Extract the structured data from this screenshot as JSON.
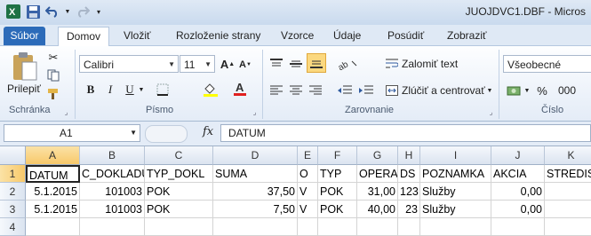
{
  "window": {
    "title": "JUOJDVC1.DBF - Micros"
  },
  "tabs": [
    {
      "label": "Súbor"
    },
    {
      "label": "Domov"
    },
    {
      "label": "Vložiť"
    },
    {
      "label": "Rozloženie strany"
    },
    {
      "label": "Vzorce"
    },
    {
      "label": "Údaje"
    },
    {
      "label": "Posúdiť"
    },
    {
      "label": "Zobraziť"
    }
  ],
  "ribbon": {
    "clipboard": {
      "paste_label": "Prilepiť",
      "group_label": "Schránka"
    },
    "font": {
      "name": "Calibri",
      "size": "11",
      "group_label": "Písmo",
      "bold": "B",
      "italic": "I",
      "underline": "U"
    },
    "alignment": {
      "wrap_label": "Zalomiť text",
      "merge_label": "Zlúčiť a centrovať",
      "group_label": "Zarovnanie"
    },
    "number": {
      "format": "Všeobecné",
      "percent": "%",
      "thousands": "000",
      "group_label": "Číslo"
    }
  },
  "formula_bar": {
    "name_box": "A1",
    "fx_label": "fx",
    "content": "DATUM"
  },
  "sheet": {
    "columns": [
      "A",
      "B",
      "C",
      "D",
      "E",
      "F",
      "G",
      "H",
      "I",
      "J",
      "K"
    ],
    "rows": [
      "1",
      "2",
      "3",
      "4"
    ],
    "data": [
      [
        "DATUM",
        "C_DOKLADU",
        "TYP_DOKL",
        "SUMA",
        "O",
        "TYP",
        "OPERAC",
        "DS",
        "POZNAMKA",
        "AKCIA",
        "STREDIS"
      ],
      [
        "5.1.2015",
        "101003",
        "POK",
        "37,50",
        "V",
        "POK",
        "31,00",
        "123",
        "Služby",
        "0,00",
        ""
      ],
      [
        "5.1.2015",
        "101003",
        "POK",
        "7,50",
        "V",
        "POK",
        "40,00",
        "23",
        "Služby",
        "0,00",
        ""
      ],
      [
        "",
        "",
        "",
        "",
        "",
        "",
        "",
        "",
        "",
        "",
        ""
      ]
    ]
  },
  "colors": {
    "file_tab": "#2c6bb9",
    "selection": "#f8c96a"
  }
}
